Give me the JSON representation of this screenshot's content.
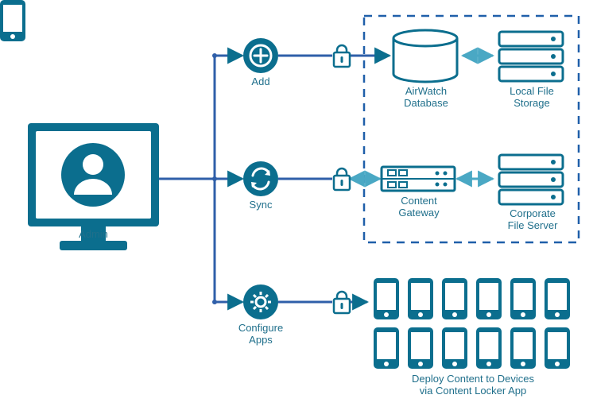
{
  "colors": {
    "teal": "#0b6e8e",
    "tealLight": "#4aa8c4",
    "lineBlue": "#2f5fa9",
    "dash": "#1f5fa9"
  },
  "labels": {
    "admin": "Admin",
    "add": "Add",
    "sync": "Sync",
    "configure": "Configure\nApps",
    "airwatch": "AirWatch\nDatabase",
    "localFile": "Local File\nStorage",
    "contentGw": "Content\nGateway",
    "corpFile": "Corporate\nFile Server",
    "deploy": "Deploy Content to Devices\nvia Content Locker App"
  },
  "icons": {
    "add": "plus-icon",
    "sync": "sync-icon",
    "configure": "gear-icon",
    "lock": "lock-icon",
    "database": "database-icon",
    "server": "server-stack-icon",
    "gateway": "gateway-icon",
    "phone": "phone-icon",
    "monitorUser": "monitor-user-icon"
  }
}
